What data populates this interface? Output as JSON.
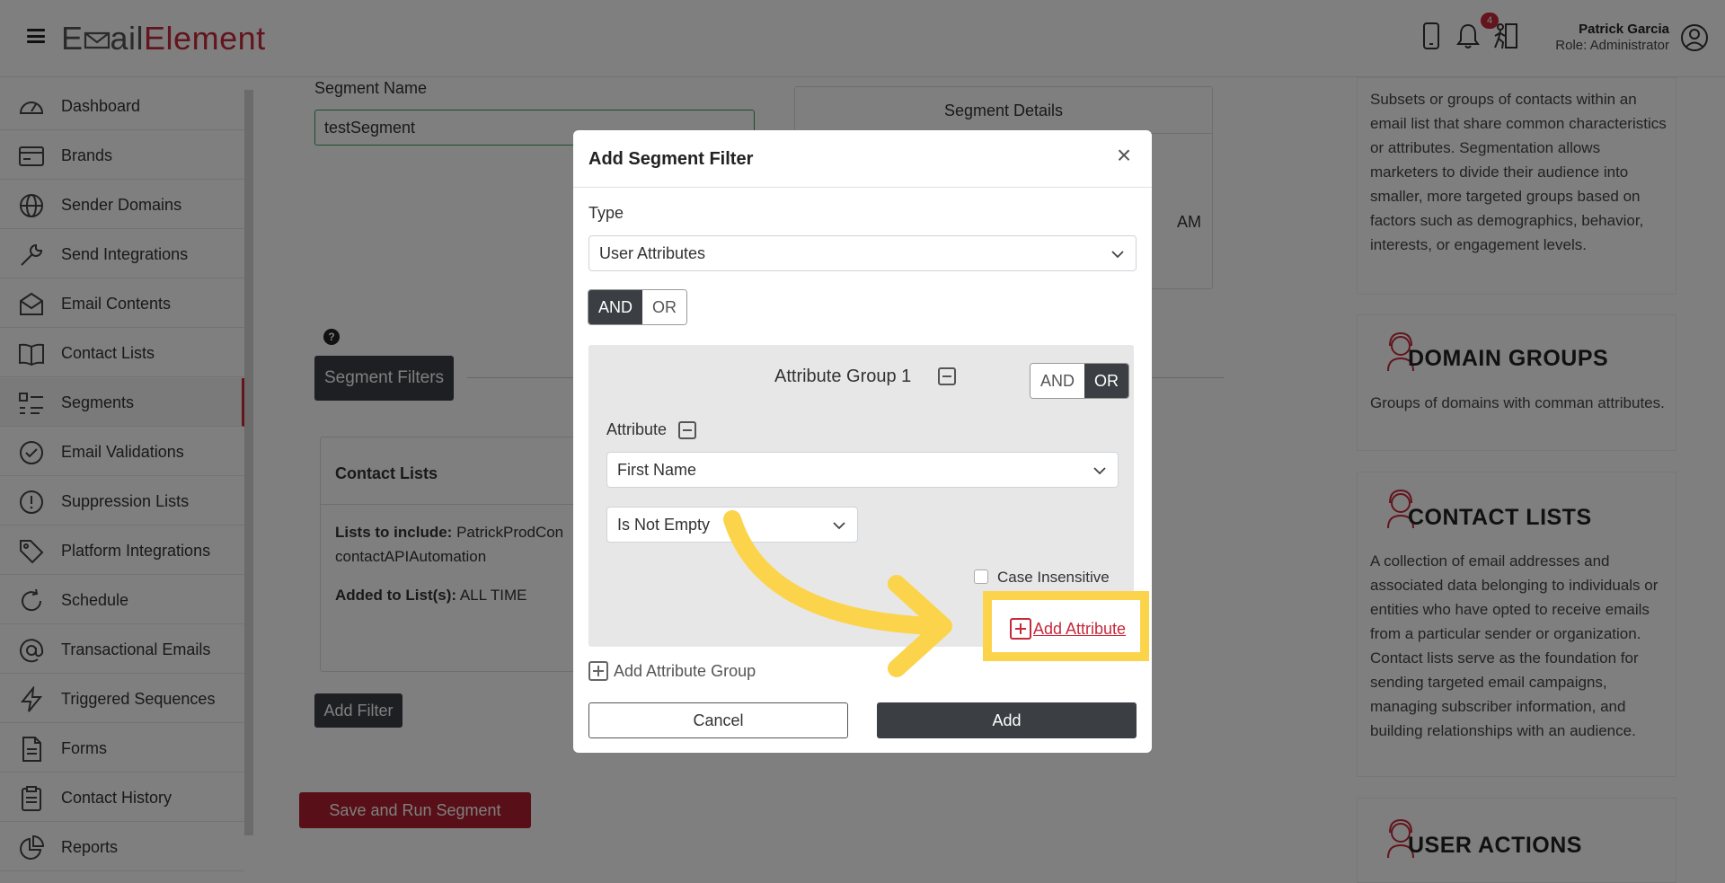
{
  "header": {
    "logo_part1": "E",
    "logo_part2": "ail",
    "logo_part3": "Element",
    "notification_count": "4",
    "user_name": "Patrick Garcia",
    "user_role": "Role: Administrator"
  },
  "sidebar": {
    "items": [
      {
        "label": "Dashboard",
        "icon": "dashboard-icon"
      },
      {
        "label": "Brands",
        "icon": "brands-icon"
      },
      {
        "label": "Sender Domains",
        "icon": "globe-icon"
      },
      {
        "label": "Send Integrations",
        "icon": "wrench-icon"
      },
      {
        "label": "Email Contents",
        "icon": "envelope-icon"
      },
      {
        "label": "Contact Lists",
        "icon": "book-icon"
      },
      {
        "label": "Segments",
        "icon": "segments-icon"
      },
      {
        "label": "Email Validations",
        "icon": "check-circle-icon"
      },
      {
        "label": "Suppression Lists",
        "icon": "exclamation-circle-icon"
      },
      {
        "label": "Platform Integrations",
        "icon": "tag-icon"
      },
      {
        "label": "Schedule",
        "icon": "refresh-icon"
      },
      {
        "label": "Transactional Emails",
        "icon": "at-icon"
      },
      {
        "label": "Triggered Sequences",
        "icon": "lightning-icon"
      },
      {
        "label": "Forms",
        "icon": "file-icon"
      },
      {
        "label": "Contact History",
        "icon": "clipboard-icon"
      },
      {
        "label": "Reports",
        "icon": "pie-chart-icon"
      }
    ]
  },
  "main": {
    "segment_name_label": "Segment Name",
    "segment_name_value": "testSegment",
    "segment_details_title": "Segment Details",
    "segment_details_partial": "AM",
    "segment_filters_button": "Segment Filters",
    "contact_lists_title": "Contact Lists",
    "lists_to_include_label": "Lists to include:",
    "lists_to_include_value": "PatrickProdCon",
    "lists_to_include_value2": "contactAPIAutomation",
    "added_to_list_label": "Added to List(s):",
    "added_to_list_value": "ALL TIME",
    "add_filter_button": "Add Filter",
    "save_run_button": "Save and Run Segment"
  },
  "info_panel": {
    "segments_text": "Subsets or groups of contacts within an email list that share common characteristics or attributes. Segmentation allows marketers to divide their audience into smaller, more targeted groups based on factors such as demographics, behavior, interests, or engagement levels.",
    "domain_groups_title": "DOMAIN GROUPS",
    "domain_groups_text": "Groups of domains with comman attributes.",
    "contact_lists_title": "CONTACT LISTS",
    "contact_lists_text": "A collection of email addresses and associated data belonging to individuals or entities who have opted to receive emails from a particular sender or organization. Contact lists serve as the foundation for sending targeted email campaigns, managing subscriber information, and building relationships with an audience.",
    "user_actions_title": "USER ACTIONS"
  },
  "modal": {
    "title": "Add Segment Filter",
    "type_label": "Type",
    "type_value": "User Attributes",
    "and_label": "AND",
    "or_label": "OR",
    "group_title": "Attribute Group 1",
    "group_and": "AND",
    "group_or": "OR",
    "attribute_label": "Attribute",
    "attribute_value": "First Name",
    "condition_value": "Is Not Empty",
    "case_insensitive_label": "Case Insensitive",
    "add_attribute_label": "Add Attribute",
    "add_attribute_group_label": "Add Attribute Group",
    "cancel_label": "Cancel",
    "add_label": "Add"
  },
  "colors": {
    "brand_red": "#c7283a",
    "dark_button": "#3b3f44",
    "highlight_yellow": "#fcd44b"
  }
}
